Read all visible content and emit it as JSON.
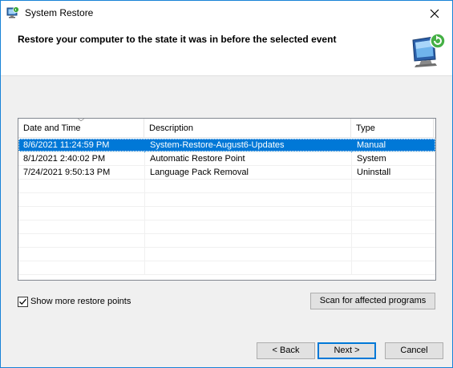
{
  "window": {
    "title": "System Restore"
  },
  "header": {
    "heading": "Restore your computer to the state it was in before the selected event"
  },
  "table": {
    "columns": [
      "Date and Time",
      "Description",
      "Type"
    ],
    "rows": [
      {
        "date": "8/6/2021 11:24:59 PM",
        "description": "System-Restore-August6-Updates",
        "type": "Manual",
        "selected": true
      },
      {
        "date": "8/1/2021 2:40:02 PM",
        "description": "Automatic Restore Point",
        "type": "System",
        "selected": false
      },
      {
        "date": "7/24/2021 9:50:13 PM",
        "description": "Language Pack Removal",
        "type": "Uninstall",
        "selected": false
      }
    ]
  },
  "options": {
    "show_more_label": "Show more restore points",
    "show_more_checked": true
  },
  "buttons": {
    "scan": "Scan for affected programs",
    "back": "< Back",
    "next": "Next >",
    "cancel": "Cancel"
  },
  "icons": {
    "app": "system-restore-icon",
    "close": "close-icon",
    "header": "monitor-restore-icon"
  },
  "colors": {
    "selection": "#0078d7",
    "accent_border": "#1883d7"
  }
}
